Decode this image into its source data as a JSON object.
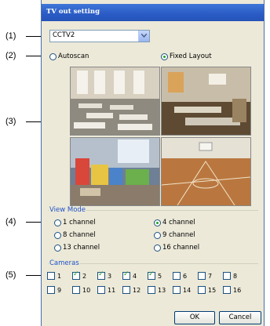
{
  "window": {
    "title": "TV out setting"
  },
  "device": {
    "selected": "CCTV2"
  },
  "layout_mode": {
    "autoscan_label": "Autoscan",
    "fixed_label": "Fixed Layout",
    "selected": "Fixed Layout"
  },
  "view_mode": {
    "label": "View Mode",
    "options": [
      "1 channel",
      "4 channel",
      "8 channel",
      "9 channel",
      "13 channel",
      "16 channel"
    ],
    "selected": "4 channel"
  },
  "cameras": {
    "label": "Cameras",
    "items": [
      {
        "label": "1",
        "checked": false
      },
      {
        "label": "2",
        "checked": true
      },
      {
        "label": "3",
        "checked": true
      },
      {
        "label": "4",
        "checked": true
      },
      {
        "label": "5",
        "checked": true
      },
      {
        "label": "6",
        "checked": false
      },
      {
        "label": "7",
        "checked": false
      },
      {
        "label": "8",
        "checked": false
      },
      {
        "label": "9",
        "checked": false
      },
      {
        "label": "10",
        "checked": false
      },
      {
        "label": "11",
        "checked": false
      },
      {
        "label": "12",
        "checked": false
      },
      {
        "label": "13",
        "checked": false
      },
      {
        "label": "14",
        "checked": false
      },
      {
        "label": "15",
        "checked": false
      },
      {
        "label": "16",
        "checked": false
      }
    ]
  },
  "buttons": {
    "ok": "OK",
    "cancel": "Cancel"
  },
  "callouts": [
    "(1)",
    "(2)",
    "(3)",
    "(4)",
    "(5)"
  ],
  "colors": {
    "titlebar": "#2a5bc5",
    "dialog_bg": "#ece9d8",
    "group_label": "#1e52c7",
    "check_green": "#21a121"
  }
}
